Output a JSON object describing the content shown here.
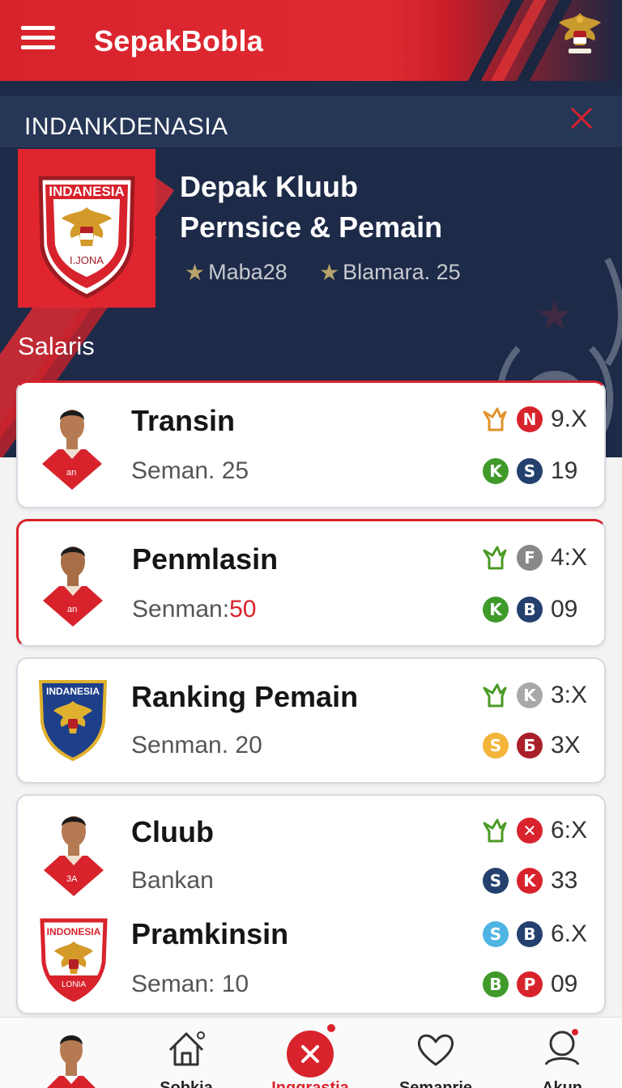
{
  "app": {
    "title": "SepakBobla"
  },
  "banner": {
    "text": "INDANKDENASIA"
  },
  "hero": {
    "badge_top_text": "INDANESIA",
    "badge_bottom_text": "I.JONA",
    "title_line1": "Depak Kluub",
    "title_line2": "Pernsice & Pemain",
    "meta": [
      "Maba28",
      "Blamara. 25"
    ],
    "section_label": "Salaris"
  },
  "items": [
    {
      "title": "Transin",
      "sub_prefix": "Seman. 25",
      "sub_highlight": "",
      "row1": {
        "icon": "fist-icon",
        "icon_color": "#e0932b",
        "circle": "N",
        "circle_color": "#d8232c",
        "value": "9.X"
      },
      "row2": {
        "circle_a": "K",
        "color_a": "#3f9a2a",
        "circle_b": "S",
        "color_b": "#23406e",
        "value": "19"
      }
    },
    {
      "title": "Penmlasin",
      "sub_prefix": "Senman:",
      "sub_highlight": "50",
      "row1": {
        "icon": "fist-icon",
        "icon_color": "#4a9a25",
        "circle": "F",
        "circle_color": "#888",
        "value": "4:X"
      },
      "row2": {
        "circle_a": "K",
        "color_a": "#3f9a2a",
        "circle_b": "B",
        "color_b": "#23406e",
        "value": "09"
      }
    },
    {
      "title": "Ranking Pemain",
      "sub_prefix": "Senman. 20",
      "sub_highlight": "",
      "row1": {
        "icon": "fist-icon",
        "icon_color": "#4a9a25",
        "circle": "K",
        "circle_color": "#a8a8a8",
        "value": "3:X"
      },
      "row2": {
        "circle_a": "S",
        "color_a": "#f3b43a",
        "circle_b": "Б",
        "color_b": "#a92028",
        "value": "3X"
      }
    },
    {
      "title": "Cluub",
      "sub_prefix": "Bankan",
      "sub_highlight": "",
      "row1": {
        "icon": "fist-icon",
        "icon_color": "#4a9a25",
        "circle": "✕",
        "circle_color": "#d8232c",
        "value": "6:X"
      },
      "row2": {
        "circle_a": "S",
        "color_a": "#23406e",
        "circle_b": "K",
        "color_b": "#d8232c",
        "value": "33"
      }
    },
    {
      "title": "Pramkinsin",
      "sub_prefix": "Seman: 10",
      "sub_highlight": "",
      "row1": {
        "circle_a": "S",
        "color_a": "#4fb4e2",
        "circle_b": "B",
        "color_b": "#23406e",
        "value": "6.X"
      },
      "row2": {
        "circle_a": "B",
        "color_a": "#3f9a2a",
        "circle_b": "P",
        "color_b": "#d8232c",
        "value": "09"
      }
    }
  ],
  "card3_badge_text": "INDANESIA",
  "card4_badge_top": "INDONESIA",
  "card4_badge_bottom": "LONIA",
  "jersey_numbers": [
    "an",
    "an",
    "3A"
  ],
  "nav": {
    "labels": [
      "Sobkia",
      "Inggrastia",
      "Semanrie",
      "Akun"
    ]
  },
  "colors": {
    "primary_red": "#d8232c",
    "navy": "#1d2a48"
  }
}
